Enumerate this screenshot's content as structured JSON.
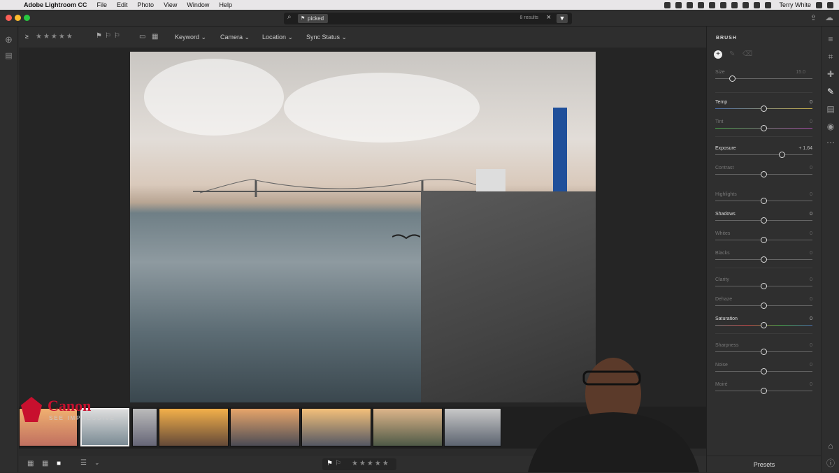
{
  "menubar": {
    "app": "Adobe Lightroom CC",
    "items": [
      "File",
      "Edit",
      "Photo",
      "View",
      "Window",
      "Help"
    ],
    "user": "Terry White"
  },
  "search": {
    "chip": "picked",
    "results": "8 results"
  },
  "toolbar": {
    "sort_label": "≥",
    "stars": "★★★★★",
    "dropdowns": [
      "Keyword",
      "Camera",
      "Location",
      "Sync Status"
    ]
  },
  "panel": {
    "title": "BRUSH",
    "size": {
      "label": "Size",
      "value": "15.0",
      "level": 0.18
    },
    "sliders": [
      {
        "label": "Temp",
        "value": "0",
        "level": 0.5,
        "active": true
      },
      {
        "label": "Tint",
        "value": "0",
        "level": 0.5,
        "active": false
      },
      {
        "label": "Exposure",
        "value": "+ 1.64",
        "level": 0.69,
        "active": true
      },
      {
        "label": "Contrast",
        "value": "0",
        "level": 0.5,
        "active": false
      },
      {
        "label": "Highlights",
        "value": "0",
        "level": 0.5,
        "active": false
      },
      {
        "label": "Shadows",
        "value": "0",
        "level": 0.5,
        "active": true
      },
      {
        "label": "Whites",
        "value": "0",
        "level": 0.5,
        "active": false
      },
      {
        "label": "Blacks",
        "value": "0",
        "level": 0.5,
        "active": false
      },
      {
        "label": "Clarity",
        "value": "0",
        "level": 0.5,
        "active": false
      },
      {
        "label": "Dehaze",
        "value": "0",
        "level": 0.5,
        "active": false
      },
      {
        "label": "Saturation",
        "value": "0",
        "level": 0.5,
        "active": true
      },
      {
        "label": "Sharpness",
        "value": "0",
        "level": 0.5,
        "active": false
      },
      {
        "label": "Noise",
        "value": "0",
        "level": 0.5,
        "active": false
      },
      {
        "label": "Moiré",
        "value": "0",
        "level": 0.5,
        "active": false
      }
    ],
    "presets_label": "Presets"
  },
  "overlay": {
    "brand": "Canon",
    "tagline": "SEE IMPRESSIVE"
  },
  "bottombar": {
    "stars": "★★★★★"
  },
  "colors": {
    "accent": "#ffffff",
    "panel_bg": "#2f2f2f",
    "canon_red": "#c8102e"
  }
}
